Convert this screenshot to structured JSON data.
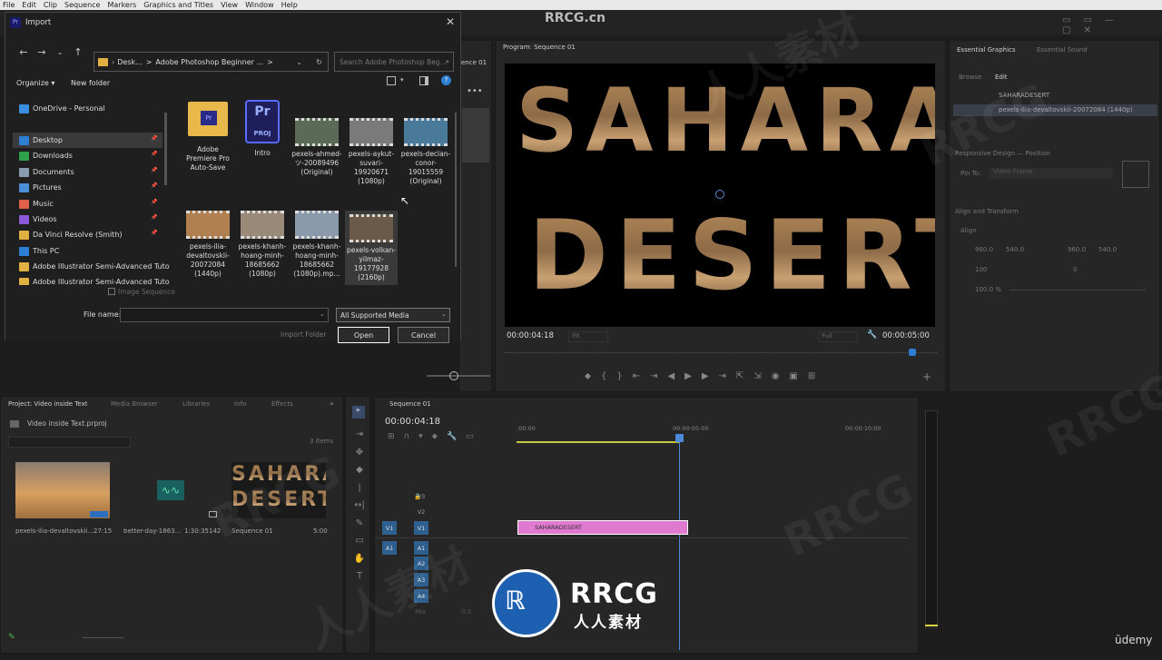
{
  "menubar": [
    "File",
    "Edit",
    "Clip",
    "Sequence",
    "Markers",
    "Graphics and Titles",
    "View",
    "Window",
    "Help"
  ],
  "watermark": {
    "top": "RRCG.cn",
    "logo_main": "RRCG",
    "logo_sub": "人人素材",
    "udemy": "ūdemy",
    "bg1": "RRCG",
    "bg2": "人人素材"
  },
  "dialog": {
    "title": "Import",
    "breadcrumb": [
      "Desk...",
      ">",
      "Adobe Photoshop Beginner ...",
      ">"
    ],
    "search_placeholder": "Search Adobe Photoshop Beg...",
    "organize": "Organize ▾",
    "new_folder": "New folder",
    "sidebar": [
      {
        "label": "OneDrive - Personal",
        "color": "#3a8de0",
        "pinned": false
      },
      {
        "label": "Desktop",
        "color": "#2d7fd4",
        "pinned": true
      },
      {
        "label": "Downloads",
        "color": "#2fa04c",
        "pinned": true
      },
      {
        "label": "Documents",
        "color": "#8a9db0",
        "pinned": true
      },
      {
        "label": "Pictures",
        "color": "#4a8fd6",
        "pinned": true
      },
      {
        "label": "Music",
        "color": "#e0604a",
        "pinned": true
      },
      {
        "label": "Videos",
        "color": "#8a5ad8",
        "pinned": true
      },
      {
        "label": "Da Vinci Resolve (Smith)",
        "color": "#e0b040",
        "pinned": true
      },
      {
        "label": "This PC",
        "color": "#2d7fd4",
        "pinned": false
      },
      {
        "label": "Adobe Illustrator Semi-Advanced Tuto",
        "color": "#e0b040",
        "pinned": false
      },
      {
        "label": "Adobe Illustrator Semi-Advanced Tuto",
        "color": "#e0b040",
        "pinned": false
      }
    ],
    "files": [
      {
        "name": "Adobe Premiere Pro Auto-Save",
        "kind": "folder"
      },
      {
        "name": "Intro",
        "kind": "proj"
      },
      {
        "name": "pexels-ahmed-ツ-20089496 (Original)",
        "kind": "video",
        "tone": "#5a6a55"
      },
      {
        "name": "pexels-aykut-suvari-19920671 (1080p)",
        "kind": "video",
        "tone": "#7a7a7a"
      },
      {
        "name": "pexels-declan-conor-19015559 (Original)",
        "kind": "video",
        "tone": "#4a7a9a"
      },
      {
        "name": "pexels-ilia-devaltovskii-20072084 (1440p)",
        "kind": "video",
        "tone": "#b08050"
      },
      {
        "name": "pexels-khanh-hoang-minh-18685662 (1080p)",
        "kind": "video",
        "tone": "#9a8a7a"
      },
      {
        "name": "pexels-khanh-hoang-minh-18685662 (1080p).mp...",
        "kind": "video",
        "tone": "#8a9aaa"
      },
      {
        "name": "pexels-volkan-yilmaz-19177928 (2160p)",
        "kind": "video",
        "tone": "#6a5a4a",
        "selected": true
      }
    ],
    "image_sequence": "Image Sequence",
    "file_name_label": "File name:",
    "file_name_value": "",
    "file_type": "All Supported Media",
    "import_folder": "Import Folder",
    "open": "Open",
    "cancel": "Cancel"
  },
  "source_tab": "ence 01",
  "program": {
    "title": "Program: Sequence 01",
    "line1": "SAHARA",
    "line2": "DESERT",
    "timecode_left": "00:00:04:18",
    "fit": "Fit",
    "full": "Full",
    "timecode_right": "00:00:05:00"
  },
  "essential": {
    "tabs": [
      "Essential Graphics",
      "Essential Sound"
    ],
    "subtabs": [
      "Browse",
      "Edit"
    ],
    "layers": [
      "SAHARADESERT",
      "pexels-ilia-devaltovskii-20072084 (1440p)"
    ],
    "responsive": "Responsive Design — Position",
    "pin_to": "Pin To:",
    "pin_val": "Video Frame",
    "align": "Align and Transform",
    "align_lbl": "Align",
    "pos_x": "960.0",
    "pos_y": "540.0",
    "anchor_x": "960.0",
    "anchor_y": "540.0",
    "scale": "100",
    "rotation": "0",
    "opacity": "100.0 %"
  },
  "project": {
    "tabs": [
      "Project: Video inside Text",
      "Media Browser",
      "Libraries",
      "Info",
      "Effects"
    ],
    "file": "Video inside Text.prproj",
    "count": "3 items",
    "items": [
      {
        "name": "pexels-ilia-devaltovskii...",
        "dur": "27:15"
      },
      {
        "name": "better-day-1863...",
        "dur": "1:30:35142"
      },
      {
        "name": "Sequence 01",
        "dur": "5:00"
      }
    ],
    "seq_l1": "SAHARA",
    "seq_l2": "DESERT"
  },
  "timeline": {
    "tab": "Sequence 01",
    "timecode": "00:00:04:18",
    "ruler": [
      ":00:00",
      "00:00:05:00",
      "00:00:10:00"
    ],
    "tracks_v": [
      "V3",
      "V2",
      "V1"
    ],
    "tracks_a": [
      "A1",
      "A2",
      "A3",
      "A4"
    ],
    "clip": "SAHARADESERT",
    "mix": "Mix",
    "mix_val": "0.0"
  }
}
